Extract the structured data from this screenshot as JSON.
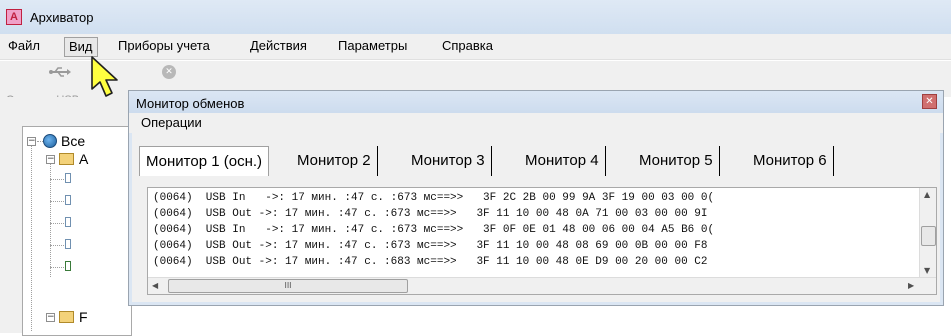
{
  "app": {
    "title": "Архиватор",
    "icon_letter": "A"
  },
  "menubar": {
    "items": [
      {
        "label": "Файл"
      },
      {
        "label": "Вид"
      },
      {
        "label": "Приборы учета"
      },
      {
        "label": "Действия"
      },
      {
        "label": "Параметры"
      },
      {
        "label": "Справка"
      }
    ]
  },
  "toolbar": {
    "usb_label": "Опрос по USB"
  },
  "tree": {
    "root_label": "Все",
    "folder1_letter": "A",
    "folder2_letter": "F"
  },
  "monitor": {
    "title": "Монитор обменов",
    "menu_label": "Операции",
    "tabs": [
      {
        "label": "Монитор 1 (осн.)"
      },
      {
        "label": "Монитор 2"
      },
      {
        "label": "Монитор 3"
      },
      {
        "label": "Монитор 4"
      },
      {
        "label": "Монитор 5"
      },
      {
        "label": "Монитор 6"
      }
    ],
    "log_lines": [
      "(0064)  USB In   ->: 17 мин. :47 с. :673 мс==>>   3F 2C 2B 00 99 9A 3F 19 00 03 00 0(",
      "(0064)  USB Out ->: 17 мин. :47 с. :673 мс==>>   3F 11 10 00 48 0A 71 00 03 00 00 9I",
      "(0064)  USB In   ->: 17 мин. :47 с. :673 мс==>>   3F 0F 0E 01 48 00 06 00 04 A5 B6 0(",
      "(0064)  USB Out ->: 17 мин. :47 с. :673 мс==>>   3F 11 10 00 48 08 69 00 0B 00 00 F8",
      "(0064)  USB Out ->: 17 мин. :47 с. :683 мс==>>   3F 11 10 00 48 0E D9 00 20 00 00 C2"
    ],
    "hscroll_grip": "III"
  }
}
